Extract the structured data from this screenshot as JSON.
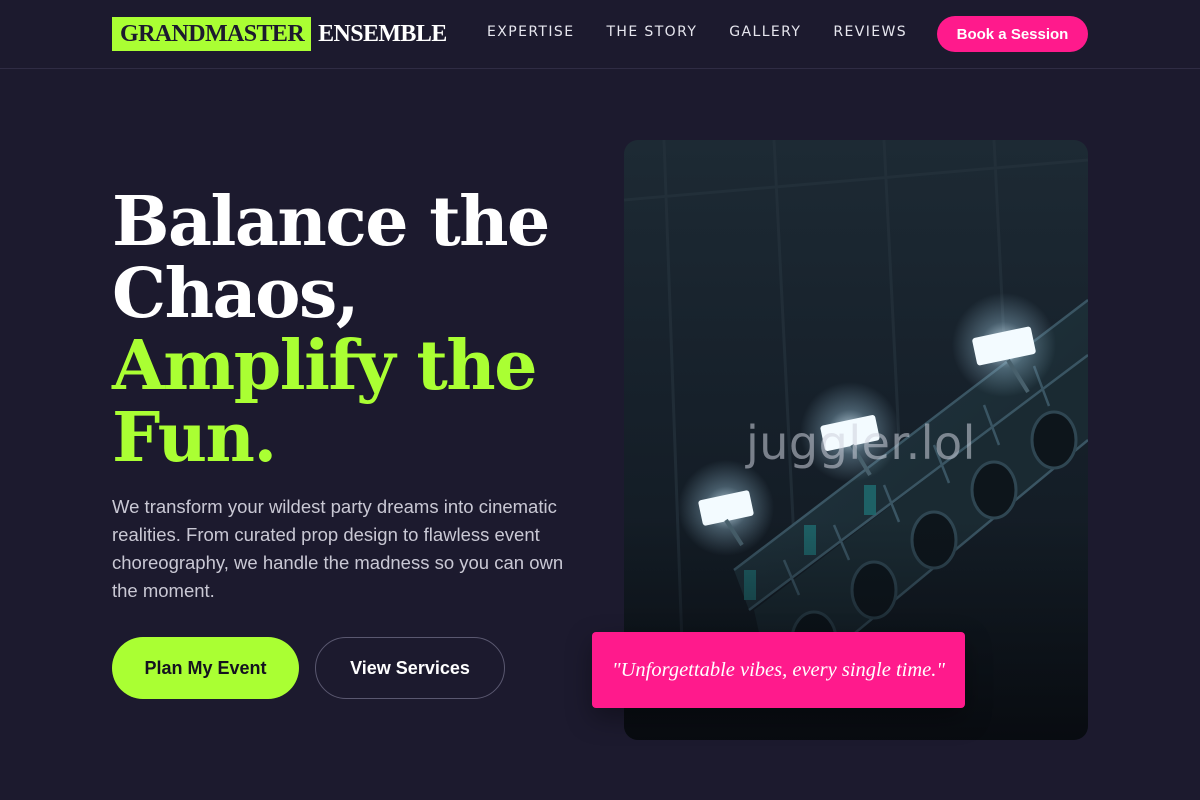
{
  "brand": {
    "name_primary": "GRANDMASTER",
    "name_secondary": "ENSEMBLE",
    "accent_color": "#aaff33",
    "highlight_color": "#ff1a8c",
    "background_color": "#1c1a2e"
  },
  "nav": {
    "items": [
      {
        "label": "EXPERTISE"
      },
      {
        "label": "THE STORY"
      },
      {
        "label": "GALLERY"
      },
      {
        "label": "REVIEWS"
      }
    ],
    "cta_label": "Book a Session"
  },
  "hero": {
    "headline_line1": "Balance the",
    "headline_line2": "Chaos,",
    "headline_line3": "Amplify the",
    "headline_line4": "Fun.",
    "description": "We transform your wildest party dreams into cinematic realities. From curated prop design to flawless event choreography, we handle the madness so you can own the moment.",
    "primary_cta": "Plan My Event",
    "secondary_cta": "View Services",
    "image_icon": "stage-lights-photo",
    "watermark": "juggler.lol",
    "quote": "\"Unforgettable vibes, every single time.\""
  }
}
